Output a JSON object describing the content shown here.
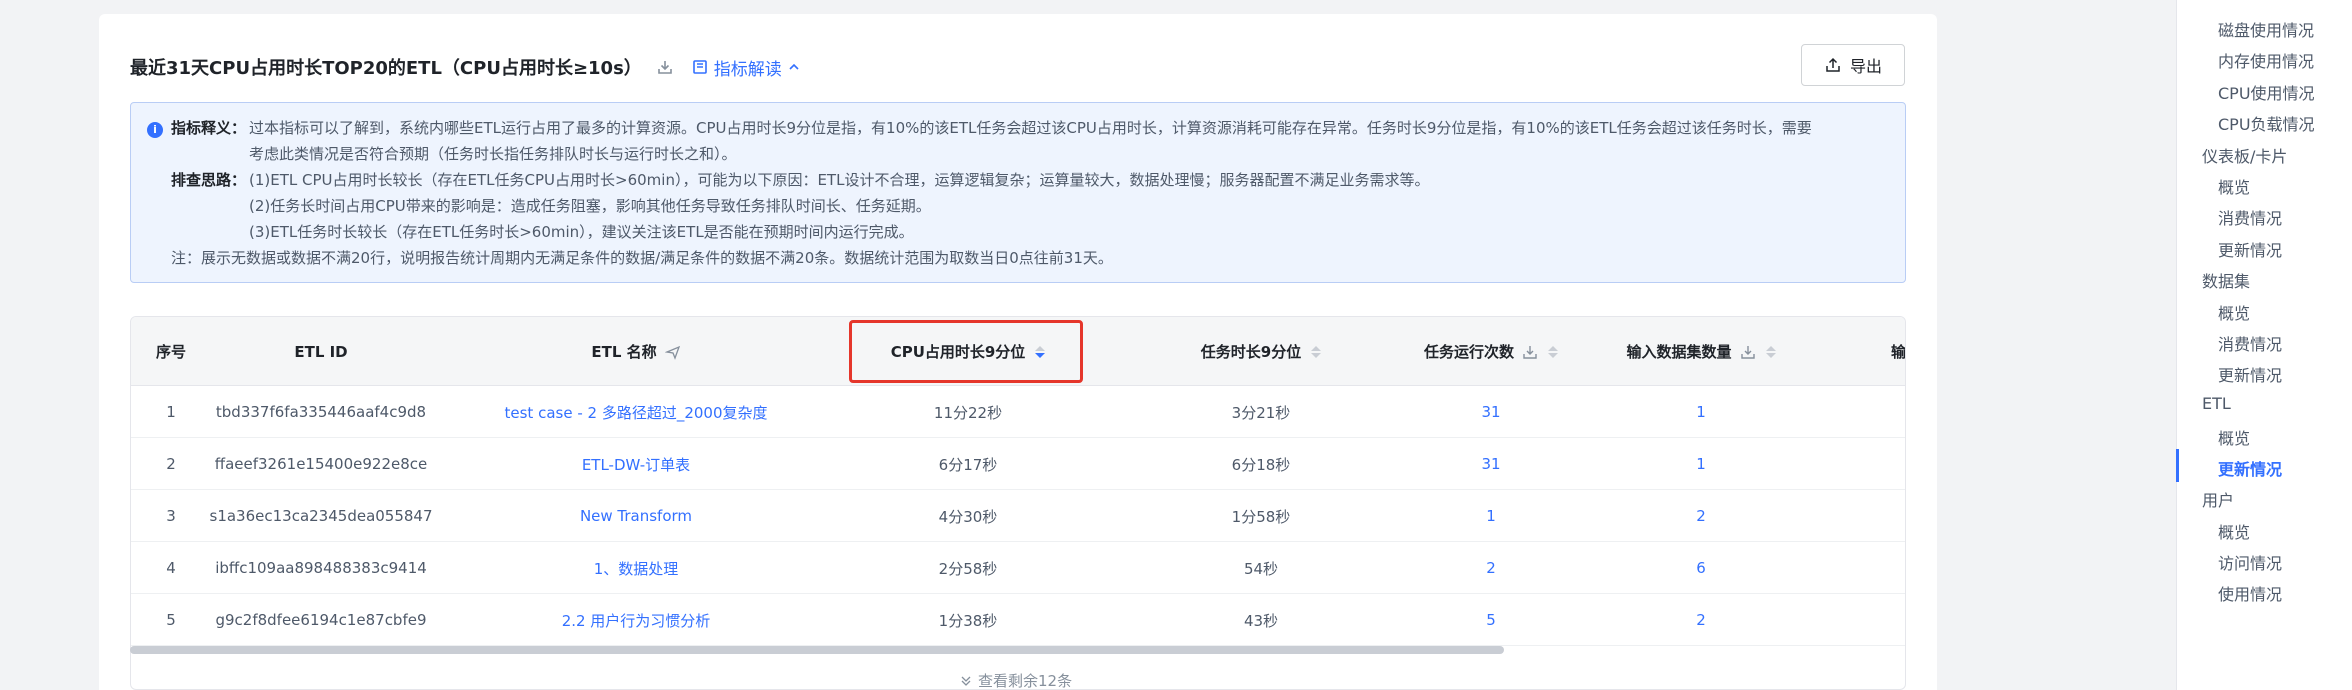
{
  "card": {
    "title": "最近31天CPU占用时长TOP20的ETL（CPU占用时长≥10s）",
    "read_link": "指标解读",
    "export_label": "导出"
  },
  "info": {
    "label_def": "指标释义：",
    "def_line1": "过本指标可以了解到，系统内哪些ETL运行占用了最多的计算资源。CPU占用时长9分位是指，有10%的该ETL任务会超过该CPU占用时长，计算资源消耗可能存在异常。任务时长9分位是指，有10%的该ETL任务会超过该任务时长，需要",
    "def_line2": "考虑此类情况是否符合预期（任务时长指任务排队时长与运行时长之和）。",
    "label_debug": "排查思路：",
    "debug_line1": "(1)ETL CPU占用时长较长（存在ETL任务CPU占用时长>60min），可能为以下原因：ETL设计不合理，运算逻辑复杂；运算量较大，数据处理慢；服务器配置不满足业务需求等。",
    "debug_line2": "(2)任务长时间占用CPU带来的影响是：造成任务阻塞，影响其他任务导致任务排队时间长、任务延期。",
    "debug_line3": "(3)ETL任务时长较长（存在ETL任务时长>60min），建议关注该ETL是否能在预期时间内运行完成。",
    "note": "注：展示无数据或数据不满20行，说明报告统计周期内无满足条件的数据/满足条件的数据不满20条。数据统计范围为取数当日0点往前31天。"
  },
  "table": {
    "headers": [
      "序号",
      "ETL ID",
      "ETL 名称",
      "CPU占用时长9分位",
      "任务时长9分位",
      "任务运行次数",
      "输入数据集数量",
      "输"
    ],
    "rows": [
      [
        "1",
        "tbd337f6fa335446aaf4c9d8",
        "test case - 2 多路径超过_2000复杂度",
        "11分22秒",
        "3分21秒",
        "31",
        "1"
      ],
      [
        "2",
        "ffaeef3261e15400e922e8ce",
        "ETL-DW-订单表",
        "6分17秒",
        "6分18秒",
        "31",
        "1"
      ],
      [
        "3",
        "s1a36ec13ca2345dea055847",
        "New Transform",
        "4分30秒",
        "1分58秒",
        "1",
        "2"
      ],
      [
        "4",
        "ibffc109aa898488383c9414",
        "1、数据处理",
        "2分58秒",
        "54秒",
        "2",
        "6"
      ],
      [
        "5",
        "g9c2f8dfee6194c1e87cbfe9",
        "2.2 用户行为习惯分析",
        "1分38秒",
        "43秒",
        "5",
        "2"
      ]
    ],
    "more_label": "查看剩余12条"
  },
  "sidebar": {
    "items": [
      "磁盘使用情况",
      "内存使用情况",
      "CPU使用情况",
      "CPU负载情况",
      "仪表板/卡片",
      "概览",
      "消费情况",
      "更新情况",
      "数据集",
      "概览",
      "消费情况",
      "更新情况",
      "ETL",
      "概览",
      "更新情况",
      "用户",
      "概览",
      "访问情况",
      "使用情况"
    ],
    "active_index": 14
  },
  "colors": {
    "accent": "#3370ff",
    "highlight": "#e5362b"
  }
}
